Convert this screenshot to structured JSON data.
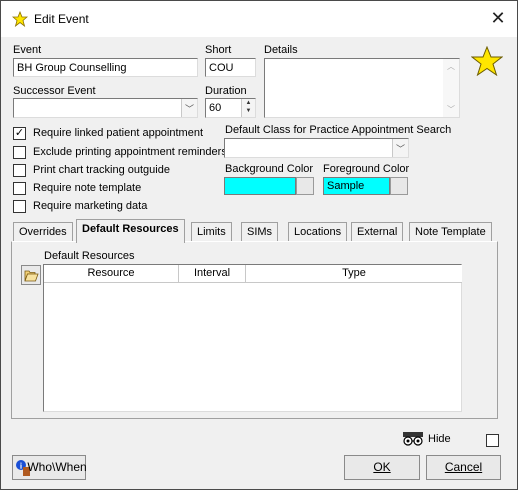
{
  "window": {
    "title": "Edit Event",
    "close_glyph": "✕"
  },
  "form": {
    "event_label": "Event",
    "event_value": "BH Group Counselling",
    "short_label": "Short",
    "short_value": "COU",
    "details_label": "Details",
    "details_value": "",
    "successor_label": "Successor Event",
    "successor_value": "",
    "duration_label": "Duration",
    "duration_value": "60",
    "checkboxes": [
      {
        "label": "Require linked patient appointment",
        "checked": true
      },
      {
        "label": "Exclude printing appointment reminders",
        "checked": false
      },
      {
        "label": "Print chart tracking outguide",
        "checked": false
      },
      {
        "label": "Require note template",
        "checked": false
      },
      {
        "label": "Require marketing data",
        "checked": false
      }
    ],
    "default_class_label": "Default Class for Practice Appointment Search",
    "default_class_value": "",
    "bg_color_label": "Background Color",
    "fg_color_label": "Foreground Color",
    "fg_sample_text": "Sample",
    "bg_color": "#00ffff",
    "fg_color": "#00ffff"
  },
  "tabs": [
    "Overrides",
    "Default Resources",
    "Limits",
    "SIMs",
    "Locations",
    "External",
    "Note Template"
  ],
  "active_tab": "Default Resources",
  "resources": {
    "section_label": "Default Resources",
    "columns": [
      "Resource",
      "Interval",
      "Type"
    ],
    "rows": []
  },
  "footer": {
    "hide_label": "Hide",
    "hide_checked": false,
    "who_when_label": "Who\\When",
    "ok_label": "OK",
    "cancel_label": "Cancel"
  },
  "icons": {
    "title_icon": "star-icon",
    "big_icon": "star-icon",
    "open_icon": "folder-open-icon",
    "hide_icon": "spy-glasses-icon",
    "who_when_icon": "info-icon"
  }
}
